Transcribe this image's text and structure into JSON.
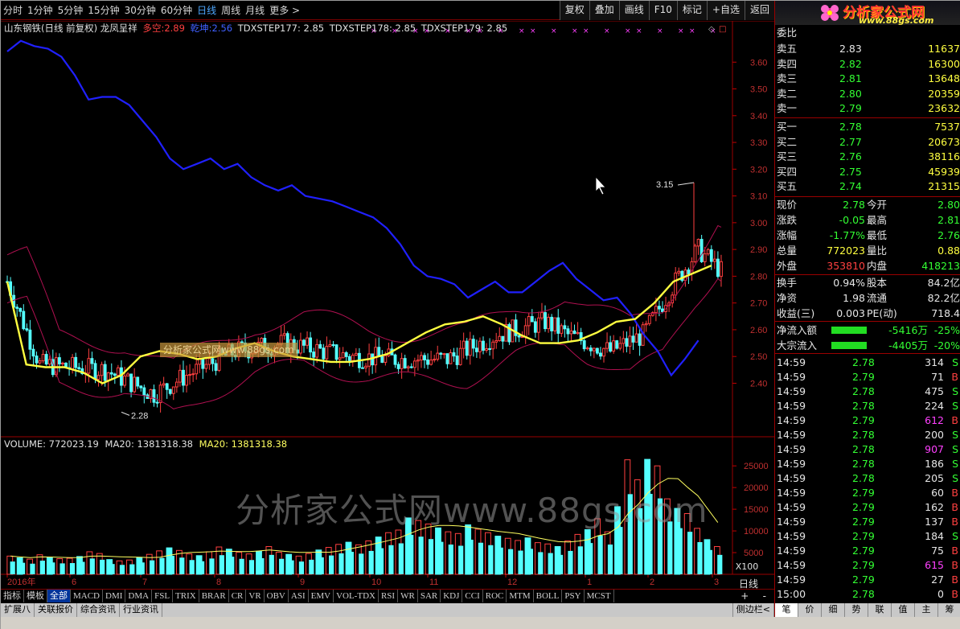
{
  "timeframes": [
    {
      "label": "分时"
    },
    {
      "label": "1分钟"
    },
    {
      "label": "5分钟"
    },
    {
      "label": "15分钟"
    },
    {
      "label": "30分钟"
    },
    {
      "label": "60分钟"
    },
    {
      "label": "日线",
      "active": true
    },
    {
      "label": "周线"
    },
    {
      "label": "月线"
    },
    {
      "label": "更多 >"
    }
  ],
  "toolbar_buttons": [
    {
      "label": "复权"
    },
    {
      "label": "叠加"
    },
    {
      "label": "画线"
    },
    {
      "label": "F10"
    },
    {
      "label": "标记"
    },
    {
      "label": "+自选"
    },
    {
      "label": "返回"
    }
  ],
  "logo": {
    "text": "分析家公式网",
    "url": "www.88gs.com"
  },
  "chart_header": {
    "stock": "山东钢铁(日线 前复权) 龙凤呈祥",
    "duokong_label": "多空:",
    "duokong_value": "2.89",
    "qiankun_label": "乾坤:",
    "qiankun_value": "2.56",
    "step177": "TDXSTEP177: 2.85",
    "step178": "TDXSTEP178: 2.85",
    "step179": "TDXSTEP179: 2.85"
  },
  "volume_header": {
    "volume": "VOLUME: 772023.19",
    "ma20a": "MA20: 1381318.38",
    "ma20b": "MA20: 1381318.38"
  },
  "watermark": "分析家公式网www.88gs.com",
  "inline_watermark": "分析家公式网www.88gs.com",
  "price_axis": [
    "3.60",
    "3.50",
    "3.40",
    "3.30",
    "3.20",
    "3.10",
    "3.00",
    "2.90",
    "2.80",
    "2.70",
    "2.60",
    "2.50",
    "2.40"
  ],
  "volume_axis": [
    "25000",
    "20000",
    "15000",
    "10000",
    "5000"
  ],
  "volume_unit": "X100",
  "period_label": "日线",
  "date_axis": [
    "2016年",
    "6",
    "7",
    "8",
    "9",
    "10",
    "11",
    "12",
    "1",
    "2",
    "3"
  ],
  "annotations": {
    "high": "3.15",
    "low": "2.28"
  },
  "indicator_tabs": [
    {
      "label": "指标"
    },
    {
      "label": "模板"
    },
    {
      "label": "全部",
      "active": true
    },
    {
      "label": "MACD"
    },
    {
      "label": "DMI"
    },
    {
      "label": "DMA"
    },
    {
      "label": "FSL"
    },
    {
      "label": "TRIX"
    },
    {
      "label": "BRAR"
    },
    {
      "label": "CR"
    },
    {
      "label": "VR"
    },
    {
      "label": "OBV"
    },
    {
      "label": "ASI"
    },
    {
      "label": "EMV"
    },
    {
      "label": "VOL-TDX"
    },
    {
      "label": "RSI"
    },
    {
      "label": "WR"
    },
    {
      "label": "SAR"
    },
    {
      "label": "KDJ"
    },
    {
      "label": "CCI"
    },
    {
      "label": "ROC"
    },
    {
      "label": "MTM"
    },
    {
      "label": "BOLL"
    },
    {
      "label": "PSY"
    },
    {
      "label": "MCST"
    }
  ],
  "bottom_tabs": [
    {
      "label": "扩展八"
    },
    {
      "label": "关联报价"
    },
    {
      "label": "综合资讯"
    },
    {
      "label": "行业资讯"
    }
  ],
  "sidebar_label": "侧边栏<",
  "pm_controls": {
    "plus": "+",
    "minus": "-"
  },
  "right_tabs": [
    {
      "label": "笔",
      "active": true
    },
    {
      "label": "价"
    },
    {
      "label": "细"
    },
    {
      "label": "势"
    },
    {
      "label": "联"
    },
    {
      "label": "值"
    },
    {
      "label": "主"
    },
    {
      "label": "筹"
    }
  ],
  "quote": {
    "weibi_label": "委比",
    "asks": [
      {
        "label": "卖五",
        "price": "2.83",
        "vol": "11637"
      },
      {
        "label": "卖四",
        "price": "2.82",
        "vol": "16300"
      },
      {
        "label": "卖三",
        "price": "2.81",
        "vol": "13648"
      },
      {
        "label": "卖二",
        "price": "2.80",
        "vol": "20359"
      },
      {
        "label": "卖一",
        "price": "2.79",
        "vol": "23632"
      }
    ],
    "bids": [
      {
        "label": "买一",
        "price": "2.78",
        "vol": "7537"
      },
      {
        "label": "买二",
        "price": "2.77",
        "vol": "20673"
      },
      {
        "label": "买三",
        "price": "2.76",
        "vol": "38116"
      },
      {
        "label": "买四",
        "price": "2.75",
        "vol": "45939"
      },
      {
        "label": "买五",
        "price": "2.74",
        "vol": "21315"
      }
    ],
    "stats": [
      {
        "l1": "现价",
        "v1": "2.78",
        "c1": "g",
        "l2": "今开",
        "v2": "2.80",
        "c2": "g"
      },
      {
        "l1": "涨跌",
        "v1": "-0.05",
        "c1": "g",
        "l2": "最高",
        "v2": "2.81",
        "c2": "g"
      },
      {
        "l1": "涨幅",
        "v1": "-1.77%",
        "c1": "g",
        "l2": "最低",
        "v2": "2.76",
        "c2": "g"
      },
      {
        "l1": "总量",
        "v1": "772023",
        "c1": "y",
        "l2": "量比",
        "v2": "0.88",
        "c2": "y"
      },
      {
        "l1": "外盘",
        "v1": "353810",
        "c1": "r",
        "l2": "内盘",
        "v2": "418213",
        "c2": "g"
      }
    ],
    "stats2": [
      {
        "l1": "换手",
        "v1": "0.94%",
        "l2": "股本",
        "v2": "84.2亿"
      },
      {
        "l1": "净资",
        "v1": "1.98",
        "l2": "流通",
        "v2": "82.2亿"
      },
      {
        "l1": "收益(三)",
        "v1": "0.003",
        "l2": "PE(动)",
        "v2": "718.4"
      }
    ],
    "flows": [
      {
        "label": "净流入额",
        "value": "-5416万",
        "pct": "-25%"
      },
      {
        "label": "大宗流入",
        "value": "-4405万",
        "pct": "-20%"
      }
    ]
  },
  "ticks": [
    {
      "t": "14:59",
      "p": "2.78",
      "v": "314",
      "s": "S",
      "vc": "w"
    },
    {
      "t": "14:59",
      "p": "2.79",
      "v": "71",
      "s": "B",
      "vc": "w"
    },
    {
      "t": "14:59",
      "p": "2.78",
      "v": "475",
      "s": "S",
      "vc": "w"
    },
    {
      "t": "14:59",
      "p": "2.78",
      "v": "224",
      "s": "S",
      "vc": "w"
    },
    {
      "t": "14:59",
      "p": "2.79",
      "v": "612",
      "s": "B",
      "vc": "m"
    },
    {
      "t": "14:59",
      "p": "2.78",
      "v": "200",
      "s": "S",
      "vc": "w"
    },
    {
      "t": "14:59",
      "p": "2.78",
      "v": "907",
      "s": "S",
      "vc": "m"
    },
    {
      "t": "14:59",
      "p": "2.78",
      "v": "186",
      "s": "S",
      "vc": "w"
    },
    {
      "t": "14:59",
      "p": "2.78",
      "v": "205",
      "s": "S",
      "vc": "w"
    },
    {
      "t": "14:59",
      "p": "2.79",
      "v": "60",
      "s": "B",
      "vc": "w"
    },
    {
      "t": "14:59",
      "p": "2.79",
      "v": "162",
      "s": "B",
      "vc": "w"
    },
    {
      "t": "14:59",
      "p": "2.79",
      "v": "137",
      "s": "B",
      "vc": "w"
    },
    {
      "t": "14:59",
      "p": "2.79",
      "v": "184",
      "s": "S",
      "vc": "w"
    },
    {
      "t": "14:59",
      "p": "2.79",
      "v": "75",
      "s": "B",
      "vc": "w"
    },
    {
      "t": "14:59",
      "p": "2.79",
      "v": "615",
      "s": "B",
      "vc": "m"
    },
    {
      "t": "14:59",
      "p": "2.79",
      "v": "27",
      "s": "B",
      "vc": "w"
    },
    {
      "t": "15:00",
      "p": "2.78",
      "v": "0",
      "s": "B",
      "vc": "w"
    }
  ],
  "chart_data": {
    "type": "candlestick",
    "ylim": [
      2.2,
      3.7
    ],
    "vol_ylim": [
      0,
      28000
    ],
    "months": [
      "2016年",
      "6",
      "7",
      "8",
      "9",
      "10",
      "11",
      "12",
      "1",
      "2",
      "3"
    ],
    "annotations": [
      {
        "label": "3.15",
        "value": 3.15
      },
      {
        "label": "2.28",
        "value": 2.28
      }
    ],
    "series": [
      {
        "name": "乾坤",
        "color": "#2020ff",
        "values": [
          3.64,
          3.68,
          3.66,
          3.65,
          3.62,
          3.55,
          3.46,
          3.47,
          3.47,
          3.44,
          3.38,
          3.32,
          3.24,
          3.2,
          3.22,
          3.24,
          3.2,
          3.22,
          3.17,
          3.14,
          3.12,
          3.14,
          3.1,
          3.09,
          3.08,
          3.06,
          3.04,
          3.02,
          2.98,
          2.92,
          2.84,
          2.8,
          2.79,
          2.77,
          2.72,
          2.75,
          2.78,
          2.74,
          2.74,
          2.78,
          2.82,
          2.85,
          2.79,
          2.75,
          2.71,
          2.72,
          2.66,
          2.58,
          2.52,
          2.43,
          2.49,
          2.56
        ]
      },
      {
        "name": "多空",
        "color": "#ffff40",
        "values": [
          2.78,
          2.47,
          2.46,
          2.46,
          2.44,
          2.4,
          2.43,
          2.5,
          2.52,
          2.51,
          2.49,
          2.5,
          2.53,
          2.55,
          2.52,
          2.5,
          2.49,
          2.48,
          2.48,
          2.49,
          2.51,
          2.55,
          2.59,
          2.62,
          2.63,
          2.65,
          2.62,
          2.58,
          2.55,
          2.55,
          2.56,
          2.59,
          2.63,
          2.64,
          2.7,
          2.78,
          2.81,
          2.84
        ]
      }
    ],
    "volume_bars": [
      4200,
      3800,
      3500,
      4500,
      3900,
      3600,
      3700,
      4100,
      5200,
      4800,
      3400,
      3100,
      3300,
      3900,
      4600,
      5400,
      6100,
      5500,
      4700,
      4300,
      5200,
      6300,
      5800,
      5100,
      4700,
      5300,
      6400,
      5100,
      4600,
      4200,
      4800,
      5600,
      6200,
      6900,
      7400,
      6800,
      7700,
      8600,
      9600,
      10200,
      13000,
      12400,
      11600,
      10700,
      9800,
      9400,
      11400,
      10400,
      9600,
      8800,
      8300,
      7800,
      8400,
      7300,
      7000,
      6400,
      7700,
      9200,
      10300,
      12800,
      9800,
      15600,
      26400,
      21800,
      26500,
      25000,
      17400,
      15200,
      14000,
      10600,
      8000,
      6400
    ],
    "volume_ma20": [
      1381318.38
    ]
  }
}
